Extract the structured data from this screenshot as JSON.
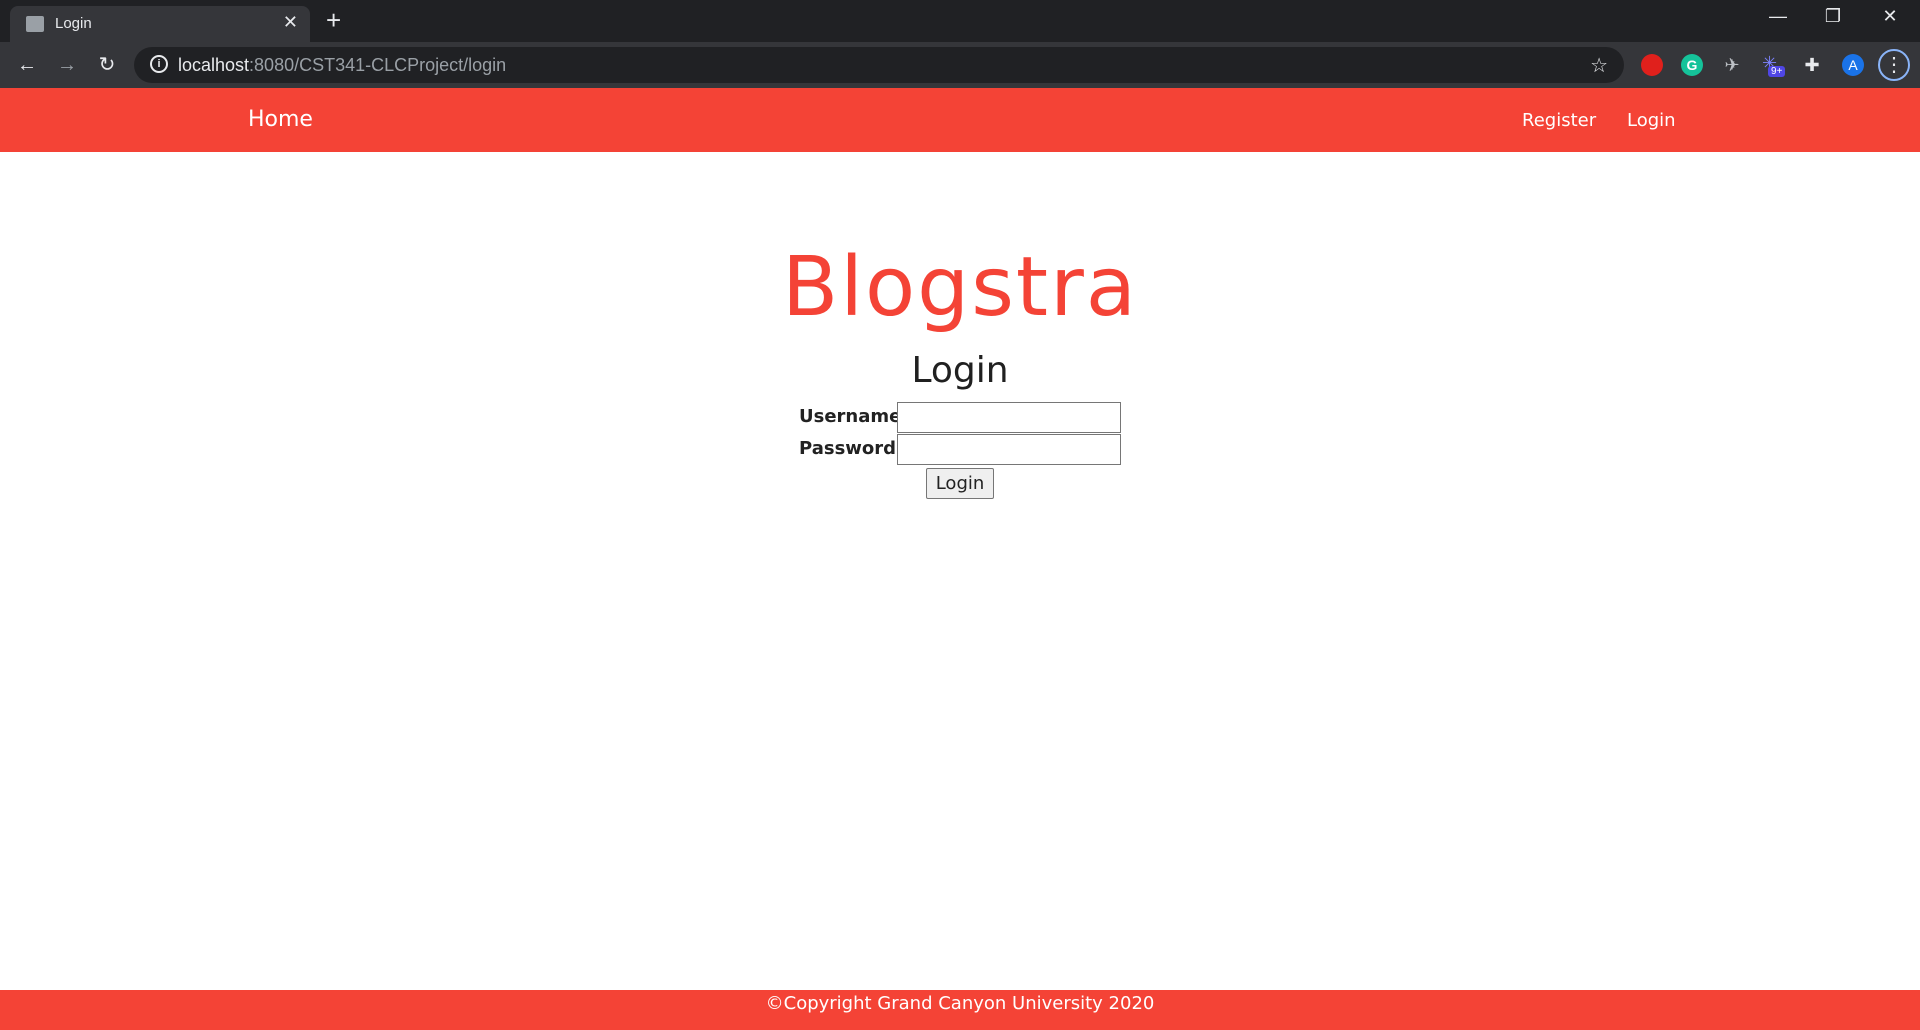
{
  "browser": {
    "tab_title": "Login",
    "url_host": "localhost",
    "url_rest": ":8080/CST341-CLCProject/login",
    "profile_initial": "A",
    "ext_badge": "9+"
  },
  "nav": {
    "home": "Home",
    "register": "Register",
    "login": "Login"
  },
  "main": {
    "brand": "Blogstra",
    "title": "Login",
    "username_label": "Username:",
    "password_label": "Password:",
    "username_value": "",
    "password_value": "",
    "submit_label": "Login"
  },
  "footer": {
    "text": "©Copyright Grand Canyon University 2020"
  },
  "colors": {
    "accent": "#f44336",
    "chrome_dark": "#202124"
  }
}
